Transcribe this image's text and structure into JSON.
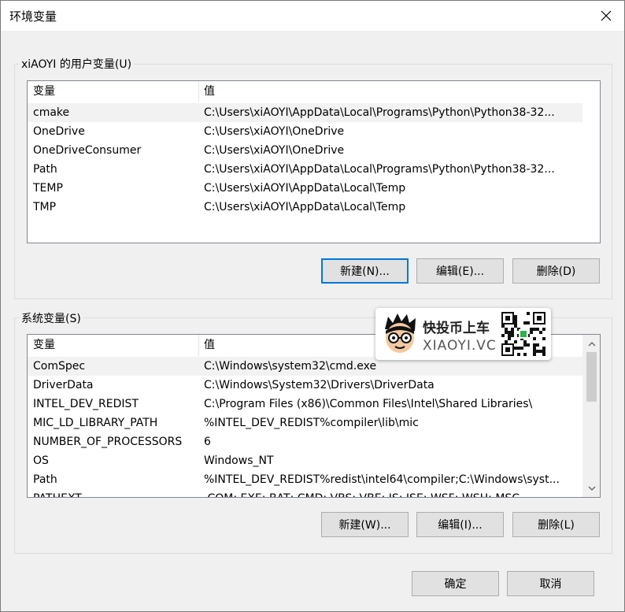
{
  "window": {
    "title": "环境变量"
  },
  "user_vars": {
    "group_label": "xiAOYI 的用户变量(U)",
    "columns": [
      "变量",
      "值"
    ],
    "rows": [
      {
        "name": "cmake",
        "value": "C:\\Users\\xiAOYI\\AppData\\Local\\Programs\\Python\\Python38-32..."
      },
      {
        "name": "OneDrive",
        "value": "C:\\Users\\xiAOYI\\OneDrive"
      },
      {
        "name": "OneDriveConsumer",
        "value": "C:\\Users\\xiAOYI\\OneDrive"
      },
      {
        "name": "Path",
        "value": "C:\\Users\\xiAOYI\\AppData\\Local\\Programs\\Python\\Python38-32..."
      },
      {
        "name": "TEMP",
        "value": "C:\\Users\\xiAOYI\\AppData\\Local\\Temp"
      },
      {
        "name": "TMP",
        "value": "C:\\Users\\xiAOYI\\AppData\\Local\\Temp"
      }
    ],
    "buttons": {
      "new": "新建(N)...",
      "edit": "编辑(E)...",
      "delete": "删除(D)"
    }
  },
  "system_vars": {
    "group_label": "系统变量(S)",
    "columns": [
      "变量",
      "值"
    ],
    "rows": [
      {
        "name": "ComSpec",
        "value": "C:\\Windows\\system32\\cmd.exe"
      },
      {
        "name": "DriverData",
        "value": "C:\\Windows\\System32\\Drivers\\DriverData"
      },
      {
        "name": "INTEL_DEV_REDIST",
        "value": "C:\\Program Files (x86)\\Common Files\\Intel\\Shared Libraries\\"
      },
      {
        "name": "MIC_LD_LIBRARY_PATH",
        "value": "%INTEL_DEV_REDIST%compiler\\lib\\mic"
      },
      {
        "name": "NUMBER_OF_PROCESSORS",
        "value": "6"
      },
      {
        "name": "OS",
        "value": "Windows_NT"
      },
      {
        "name": "Path",
        "value": "%INTEL_DEV_REDIST%redist\\intel64\\compiler;C:\\Windows\\syst..."
      },
      {
        "name": "PATHEXT",
        "value": ".COM;.EXE;.BAT;.CMD;.VBS;.VBE;.JS;.JSE;.WSF;.WSH;.MSC"
      }
    ],
    "buttons": {
      "new": "新建(W)...",
      "edit": "编辑(I)...",
      "delete": "删除(L)"
    }
  },
  "footer": {
    "ok": "确定",
    "cancel": "取消"
  },
  "watermark": {
    "brand": "快投币上车",
    "site": "XIAOYI.VC"
  },
  "colors": {
    "accent": "#0078d7",
    "selected_row": "#f2f2f2"
  }
}
